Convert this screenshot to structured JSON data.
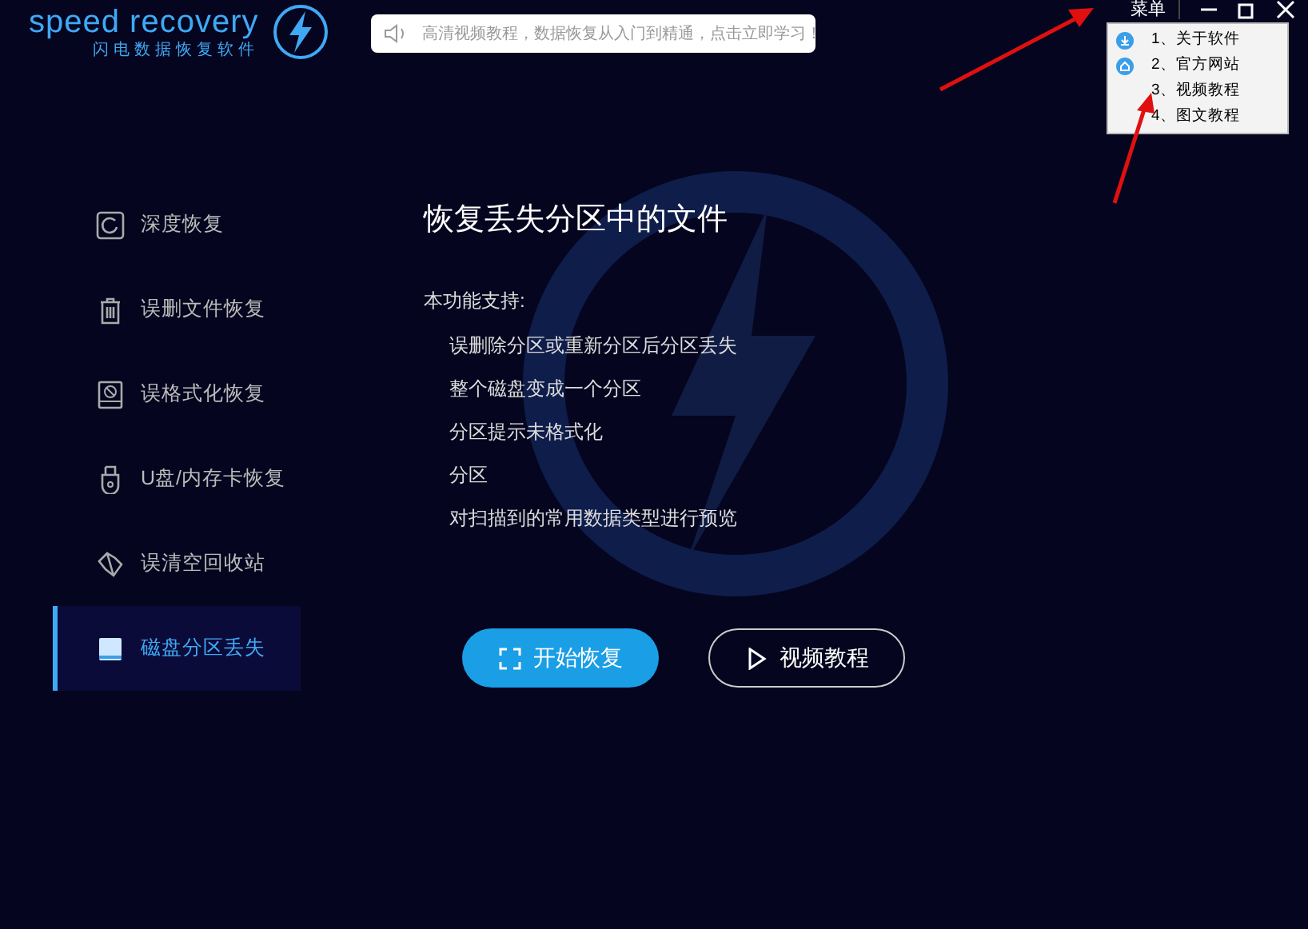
{
  "logo": {
    "name": "speed recovery",
    "subtitle": "闪电数据恢复软件"
  },
  "notice": {
    "text": "高清视频教程，数据恢复从入门到精通，点击立即学习！"
  },
  "titlebar": {
    "menu_label": "菜单"
  },
  "menu": [
    {
      "label": "1、关于软件"
    },
    {
      "label": "2、官方网站"
    },
    {
      "label": "3、视频教程"
    },
    {
      "label": "4、图文教程"
    }
  ],
  "sidebar": {
    "items": [
      {
        "label": "深度恢复",
        "selected": false
      },
      {
        "label": "误删文件恢复",
        "selected": false
      },
      {
        "label": "误格式化恢复",
        "selected": false
      },
      {
        "label": "U盘/内存卡恢复",
        "selected": false
      },
      {
        "label": "误清空回收站",
        "selected": false
      },
      {
        "label": "磁盘分区丢失",
        "selected": true
      }
    ]
  },
  "content": {
    "title": "恢复丢失分区中的文件",
    "intro": "本功能支持:",
    "features": [
      "误删除分区或重新分区后分区丢失",
      "整个磁盘变成一个分区",
      "分区提示未格式化",
      "分区",
      "对扫描到的常用数据类型进行预览"
    ]
  },
  "buttons": [
    {
      "label": "开始恢复",
      "kind": "primary"
    },
    {
      "label": "视频教程",
      "kind": "outline"
    }
  ]
}
